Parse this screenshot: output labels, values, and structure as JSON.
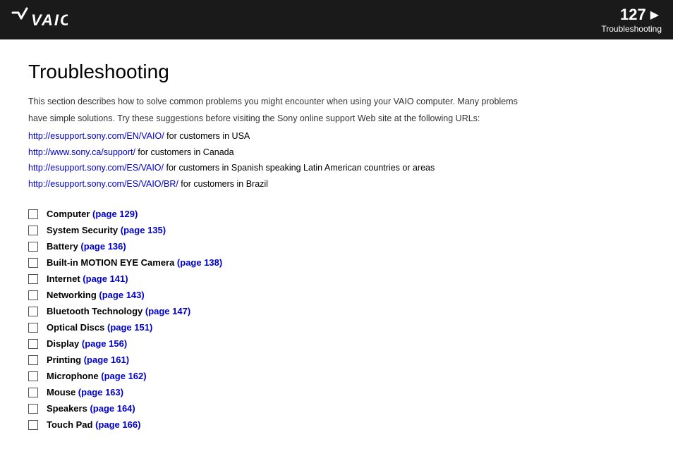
{
  "header": {
    "logo_text": "VAIO",
    "page_number": "127",
    "arrow": "▶",
    "section_title": "Troubleshooting"
  },
  "page": {
    "title": "Troubleshooting",
    "intro_line1": "This section describes how to solve common problems you might encounter when using your VAIO computer. Many problems",
    "intro_line2": "have simple solutions. Try these suggestions before visiting the Sony online support Web site at the following URLs:",
    "links": [
      {
        "url": "http://esupport.sony.com/EN/VAIO/",
        "suffix": " for customers in USA"
      },
      {
        "url": "http://www.sony.ca/support/",
        "suffix": " for customers in Canada"
      },
      {
        "url": "http://esupport.sony.com/ES/VAIO/",
        "suffix": " for customers in Spanish speaking Latin American countries or areas"
      },
      {
        "url": "http://esupport.sony.com/ES/VAIO/BR/",
        "suffix": " for customers in Brazil"
      }
    ],
    "toc_items": [
      {
        "label": "Computer",
        "page_ref": "(page 129)"
      },
      {
        "label": "System Security",
        "page_ref": "(page 135)"
      },
      {
        "label": "Battery",
        "page_ref": "(page 136)"
      },
      {
        "label": "Built-in MOTION EYE Camera",
        "page_ref": "(page 138)"
      },
      {
        "label": "Internet",
        "page_ref": "(page 141)"
      },
      {
        "label": "Networking",
        "page_ref": "(page 143)"
      },
      {
        "label": "Bluetooth Technology",
        "page_ref": "(page 147)"
      },
      {
        "label": "Optical Discs",
        "page_ref": "(page 151)"
      },
      {
        "label": "Display",
        "page_ref": "(page 156)"
      },
      {
        "label": "Printing",
        "page_ref": "(page 161)"
      },
      {
        "label": "Microphone",
        "page_ref": "(page 162)"
      },
      {
        "label": "Mouse",
        "page_ref": "(page 163)"
      },
      {
        "label": "Speakers",
        "page_ref": "(page 164)"
      },
      {
        "label": "Touch Pad",
        "page_ref": "(page 166)"
      }
    ]
  }
}
